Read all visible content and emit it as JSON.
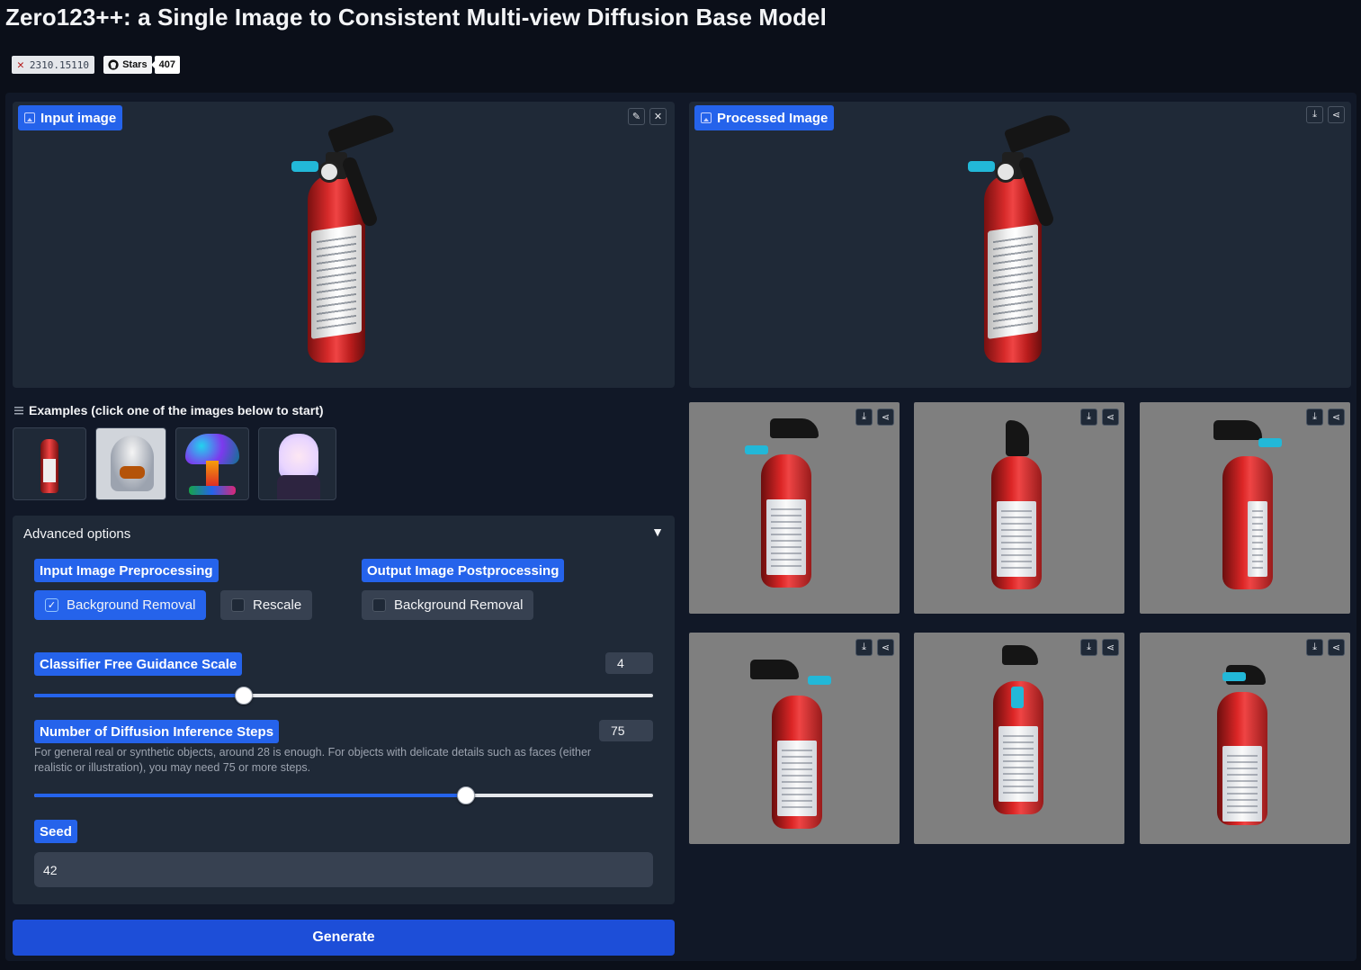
{
  "page": {
    "title": "Zero123++: a Single Image to Consistent Multi-view Diffusion Base Model"
  },
  "badges": {
    "arxiv": "2310.15110",
    "github_label": "Stars",
    "github_count": "407"
  },
  "input_panel": {
    "label": "Input image",
    "icons": [
      "edit-icon",
      "close-icon"
    ]
  },
  "processed_panel": {
    "label": "Processed Image",
    "icons": [
      "download-icon",
      "share-icon"
    ]
  },
  "examples": {
    "heading": "Examples (click one of the images below to start)",
    "items": [
      "fire-extinguisher",
      "ghost-burger",
      "mushroom",
      "anime-girl"
    ]
  },
  "advanced": {
    "title": "Advanced options",
    "preprocessing": {
      "label": "Input Image Preprocessing",
      "bg_removal": "Background Removal",
      "bg_removal_checked": true,
      "rescale": "Rescale",
      "rescale_checked": false
    },
    "postprocessing": {
      "label": "Output Image Postprocessing",
      "bg_removal": "Background Removal",
      "bg_removal_checked": false
    },
    "cfg": {
      "label": "Classifier Free Guidance Scale",
      "value": "4",
      "fraction": 0.338
    },
    "steps": {
      "label": "Number of Diffusion Inference Steps",
      "value": "75",
      "fraction": 0.698,
      "info": "For general real or synthetic objects, around 28 is enough. For objects with delicate details such as faces (either realistic or illustration), you may need 75 or more steps."
    },
    "seed": {
      "label": "Seed",
      "value": "42"
    }
  },
  "generate": {
    "label": "Generate"
  },
  "output_views": {
    "count": 6,
    "icons": [
      "download-icon",
      "share-icon"
    ]
  },
  "colors": {
    "accent": "#2563eb",
    "background": "#0b0f19",
    "panel": "#1f2937"
  }
}
